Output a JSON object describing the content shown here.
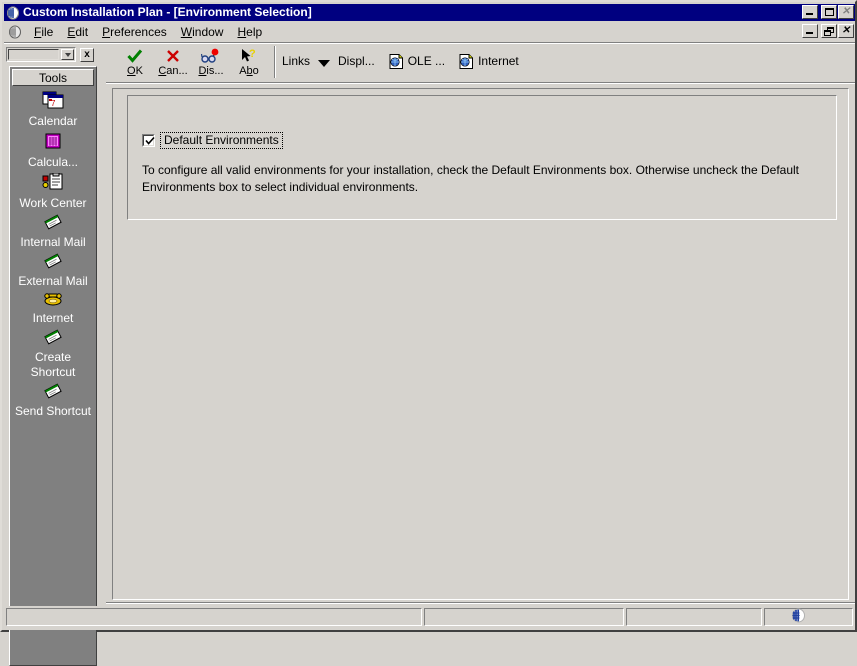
{
  "window": {
    "title": "Custom Installation Plan - [Environment Selection]",
    "title_icon": "globe-icon",
    "controls": {
      "minimize": "minimize-icon",
      "maximize": "maximize-icon",
      "close": "close-icon",
      "child_minimize": "child-minimize-icon",
      "child_restore": "child-restore-icon",
      "child_close": "child-close-icon"
    }
  },
  "menubar": {
    "icon": "globe-icon",
    "items": [
      {
        "label": "File",
        "mnemonic": "F"
      },
      {
        "label": "Edit",
        "mnemonic": "E"
      },
      {
        "label": "Preferences",
        "mnemonic": "P"
      },
      {
        "label": "Window",
        "mnemonic": "W"
      },
      {
        "label": "Help",
        "mnemonic": "H"
      }
    ]
  },
  "sidebar": {
    "combo_value": "",
    "close_label": "x",
    "header": "Tools",
    "items": [
      {
        "label": "Calendar",
        "icon": "calendar-icon"
      },
      {
        "label": "Calcula...",
        "icon": "calculator-icon"
      },
      {
        "label": "Work Center",
        "icon": "work-center-icon"
      },
      {
        "label": "Internal Mail",
        "icon": "internal-mail-icon"
      },
      {
        "label": "External Mail",
        "icon": "external-mail-icon"
      },
      {
        "label": "Internet",
        "icon": "telephone-icon"
      },
      {
        "label": "Create Shortcut",
        "icon": "create-shortcut-icon"
      },
      {
        "label": "Send Shortcut",
        "icon": "send-shortcut-icon"
      }
    ]
  },
  "toolbar": {
    "buttons": [
      {
        "label": "OK",
        "mnemonic": "O",
        "icon": "green-check-icon"
      },
      {
        "label": "Can...",
        "mnemonic": "C",
        "icon": "red-x-icon"
      },
      {
        "label": "Dis...",
        "mnemonic": "D",
        "icon": "glasses-balloon-icon"
      },
      {
        "label": "Abo",
        "mnemonic": "b",
        "icon": "arrow-question-icon"
      }
    ],
    "links_label": "Links",
    "links_dropdown_icon": "triangle-down-icon",
    "links": [
      {
        "label": "Displ...",
        "icon": ""
      },
      {
        "label": "OLE ...",
        "icon": "ole-document-icon"
      },
      {
        "label": "Internet",
        "icon": "internet-document-icon"
      }
    ]
  },
  "form": {
    "checkbox": {
      "label": "Default Environments",
      "checked": true
    },
    "description": "To configure all valid environments for your installation, check the Default Environments box.  Otherwise uncheck the Default Environments box to select individual environments."
  },
  "statusbar": {
    "pane1": "",
    "pane2": "",
    "pane3": "",
    "icon": "globe-icon"
  },
  "colors": {
    "titlebar": "#000080",
    "face": "#d6d3ce",
    "sidebar_panel": "#808080",
    "accent_check": "#008000",
    "accent_x": "#cc0000"
  }
}
